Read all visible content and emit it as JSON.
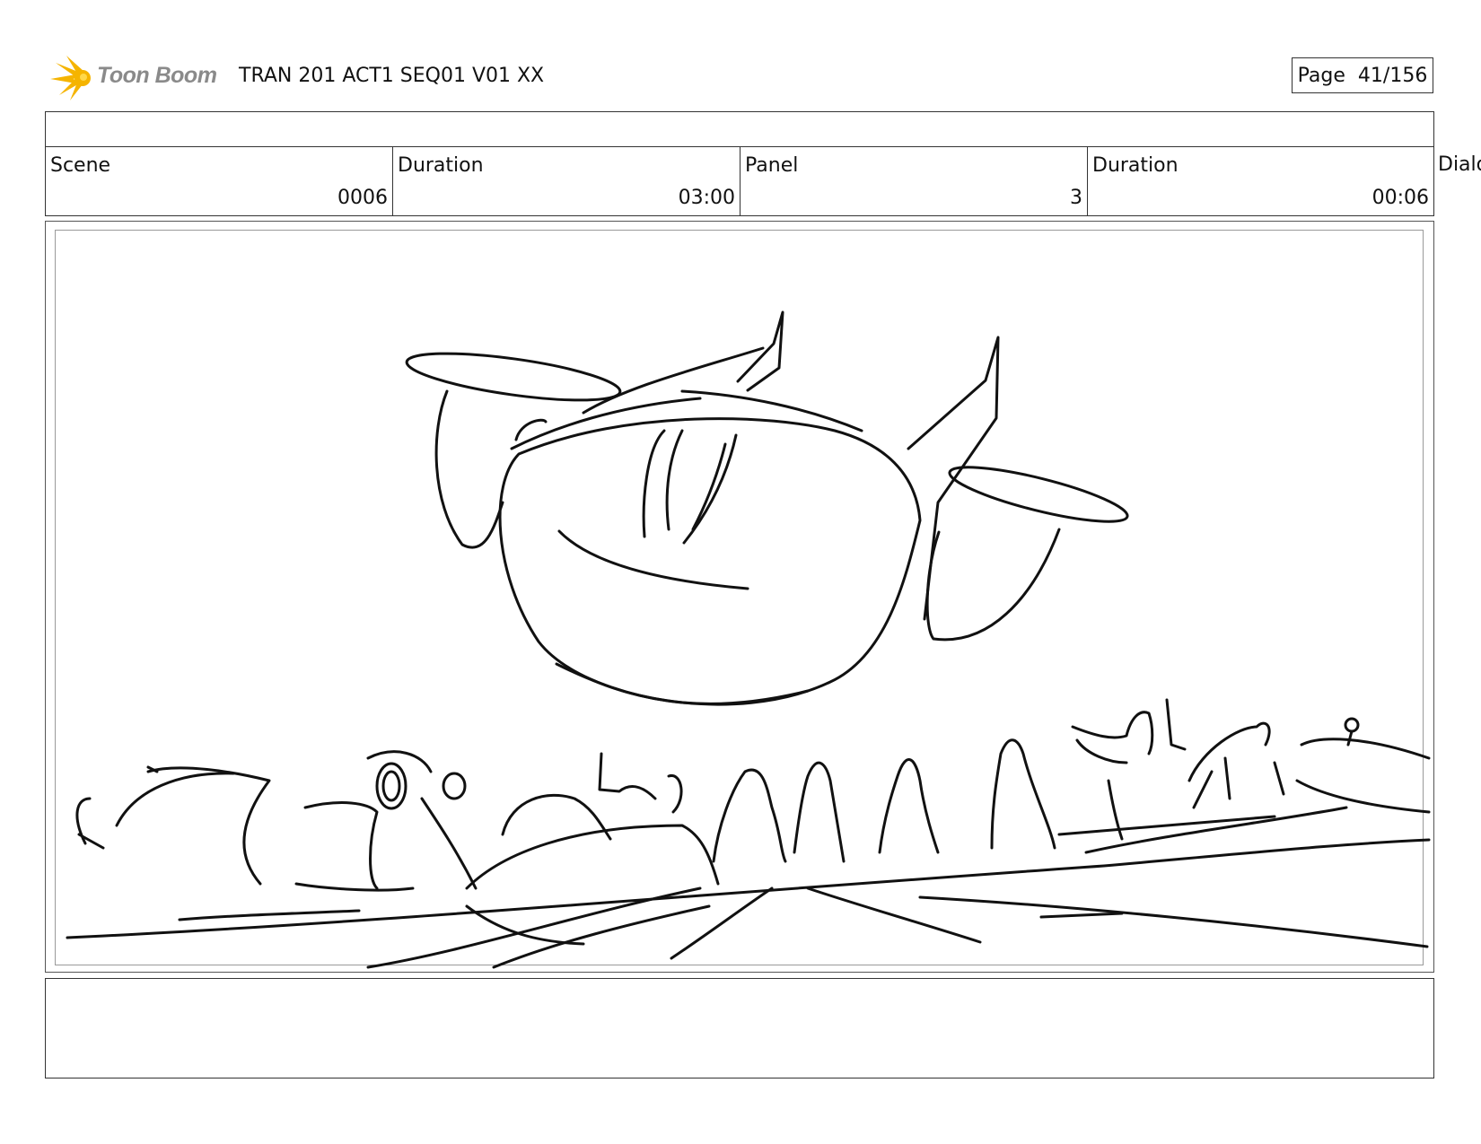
{
  "header": {
    "logo_text": "Toon Boom",
    "title": "TRAN 201 ACT1 SEQ01 V01 XX",
    "page_label": "Page",
    "page_number": "41/156"
  },
  "info": {
    "scene_label": "Scene",
    "scene_value": "0006",
    "scene_duration_label": "Duration",
    "scene_duration_value": "03:00",
    "panel_label": "Panel",
    "panel_value": "3",
    "panel_duration_label": "Duration",
    "panel_duration_value": "00:06",
    "dialog_label_partial": "Dialo"
  },
  "panel": {
    "drawing": "storyboard-sketch",
    "ink_color": "#111111"
  },
  "colors": {
    "logo_star": "#f5b400",
    "logo_text": "#8a8a8a",
    "border": "#333333"
  }
}
